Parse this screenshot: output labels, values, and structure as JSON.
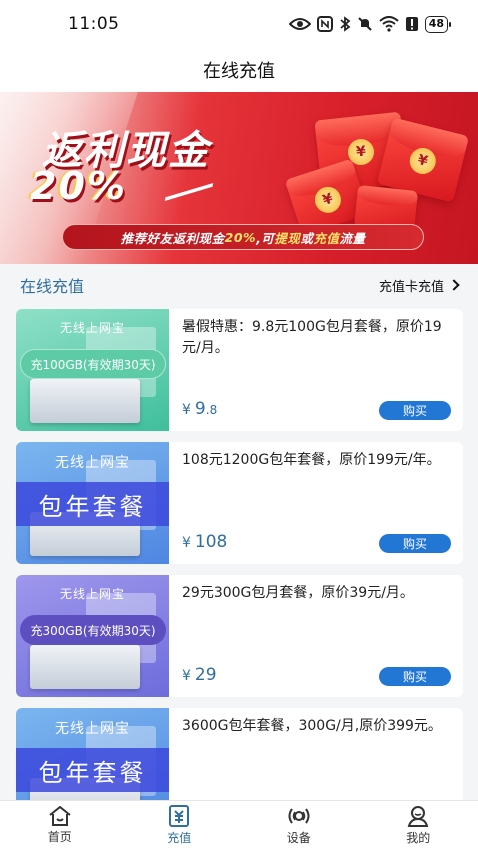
{
  "status_bar": {
    "time": "11:05",
    "battery": "48"
  },
  "header": {
    "title": "在线充值"
  },
  "banner": {
    "title": "返利现金",
    "percent": "20%",
    "slogan_parts": [
      "推荐好友返利现金",
      "20%",
      ",可",
      "提现",
      "或",
      "充值",
      "流量"
    ]
  },
  "section": {
    "title": "在线充值",
    "card_recharge_label": "充值卡充值"
  },
  "products": [
    {
      "thumb_brand": "无线上网宝",
      "thumb_label": "充100GB(有效期30天)",
      "thumb_style": "green",
      "desc": "暑假特惠：9.8元100G包月套餐，原价19元/月。",
      "currency": "¥",
      "price_main": "9",
      "price_dec": ".8",
      "buy_label": "购买"
    },
    {
      "thumb_brand": "无线上网宝",
      "thumb_label": "包年套餐",
      "thumb_style": "blue",
      "desc": "108元1200G包年套餐，原价199元/年。",
      "currency": "¥",
      "price_main": "108",
      "price_dec": "",
      "buy_label": "购买"
    },
    {
      "thumb_brand": "无线上网宝",
      "thumb_label": "充300GB(有效期30天)",
      "thumb_style": "purple",
      "desc": "29元300G包月套餐，原价39元/月。",
      "currency": "¥",
      "price_main": "29",
      "price_dec": "",
      "buy_label": "购买"
    },
    {
      "thumb_brand": "无线上网宝",
      "thumb_label": "包年套餐",
      "thumb_style": "blue",
      "desc": "3600G包年套餐，300G/月,原价399元。",
      "currency": "",
      "price_main": "",
      "price_dec": "",
      "buy_label": ""
    }
  ],
  "tabbar": {
    "items": [
      {
        "label": "首页",
        "icon": "home-icon"
      },
      {
        "label": "充值",
        "icon": "recharge-icon",
        "active": true
      },
      {
        "label": "设备",
        "icon": "device-icon"
      },
      {
        "label": "我的",
        "icon": "profile-icon"
      }
    ],
    "active_color": "#2f6fa3"
  }
}
